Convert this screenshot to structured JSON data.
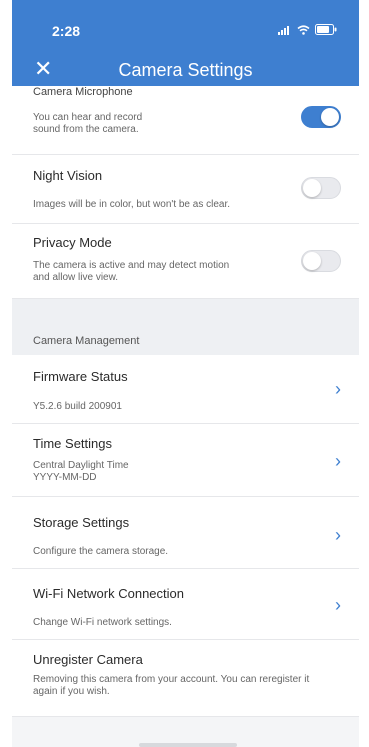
{
  "status": {
    "time": "2:28"
  },
  "header": {
    "title": "Camera Settings",
    "close_icon": "close-icon"
  },
  "colors": {
    "accent": "#3e7fd0",
    "section_bg": "#eef0f3"
  },
  "settings": {
    "microphone": {
      "title": "Camera Microphone",
      "desc": "You can hear and record sound from the camera.",
      "enabled": true
    },
    "night_vision": {
      "title": "Night Vision",
      "desc": "Images will be in color, but won't be as clear.",
      "enabled": false
    },
    "privacy_mode": {
      "title": "Privacy Mode",
      "desc": "The camera is active and may detect motion and allow live view.",
      "enabled": false
    }
  },
  "management": {
    "section_label": "Camera Management",
    "firmware": {
      "title": "Firmware Status",
      "desc": "Y5.2.6 build 200901"
    },
    "time": {
      "title": "Time Settings",
      "desc_line1": "Central Daylight Time",
      "desc_line2": "YYYY-MM-DD"
    },
    "storage": {
      "title": "Storage Settings",
      "desc": "Configure the camera storage."
    },
    "wifi": {
      "title": "Wi-Fi Network Connection",
      "desc": "Change Wi-Fi network settings."
    },
    "unregister": {
      "title": "Unregister Camera",
      "desc": "Removing this camera from your account. You can reregister it again if you wish."
    }
  }
}
